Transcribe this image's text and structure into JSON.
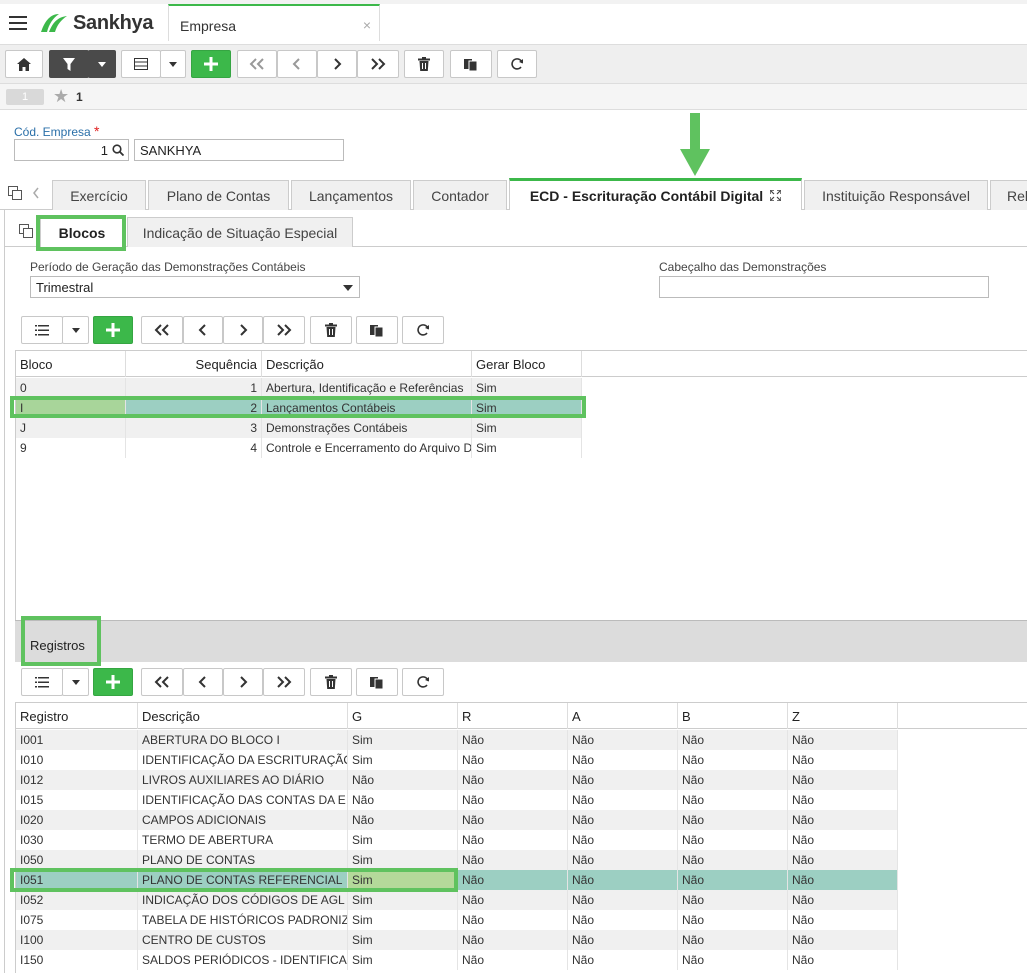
{
  "app": {
    "brand": "Sankhya",
    "tab_title": "Empresa",
    "tab_close": "×"
  },
  "record": {
    "index": "1",
    "favorites": "1"
  },
  "form": {
    "code_label": "Cód. Empresa",
    "required_mark": "*",
    "code_value": "1",
    "name_value": "SANKHYA"
  },
  "main_tabs": [
    {
      "label": "Exercício"
    },
    {
      "label": "Plano de Contas"
    },
    {
      "label": "Lançamentos"
    },
    {
      "label": "Contador"
    },
    {
      "label": "ECD - Escrituração Contábil Digital"
    },
    {
      "label": "Instituição Responsável"
    },
    {
      "label": "Rel"
    }
  ],
  "sub_tabs": [
    {
      "label": "Blocos"
    },
    {
      "label": "Indicação de Situação Especial"
    }
  ],
  "period": {
    "label": "Período de Geração das Demonstrações Contábeis",
    "value": "Trimestral"
  },
  "header_field": {
    "label": "Cabeçalho das Demonstrações",
    "value": ""
  },
  "blocos_grid": {
    "columns": [
      "Bloco",
      "Sequência",
      "Descrição",
      "Gerar Bloco"
    ],
    "rows": [
      [
        "0",
        "1",
        "Abertura, Identificação e Referências",
        "Sim"
      ],
      [
        "I",
        "2",
        "Lançamentos Contábeis",
        "Sim"
      ],
      [
        "J",
        "3",
        "Demonstrações Contábeis",
        "Sim"
      ],
      [
        "9",
        "4",
        "Controle e Encerramento do Arquivo D",
        "Sim"
      ]
    ],
    "selected_row": 1
  },
  "registros": {
    "title": "Registros",
    "columns": [
      "Registro",
      "Descrição",
      "G",
      "R",
      "A",
      "B",
      "Z"
    ],
    "rows": [
      [
        "I001",
        "ABERTURA DO BLOCO I",
        "Sim",
        "Não",
        "Não",
        "Não",
        "Não"
      ],
      [
        "I010",
        "IDENTIFICAÇÃO DA ESCRITURAÇÃO",
        "Sim",
        "Não",
        "Não",
        "Não",
        "Não"
      ],
      [
        "I012",
        "LIVROS AUXILIARES AO DIÁRIO",
        "Não",
        "Não",
        "Não",
        "Não",
        "Não"
      ],
      [
        "I015",
        "IDENTIFICAÇÃO DAS CONTAS DA E",
        "Não",
        "Não",
        "Não",
        "Não",
        "Não"
      ],
      [
        "I020",
        "CAMPOS ADICIONAIS",
        "Não",
        "Não",
        "Não",
        "Não",
        "Não"
      ],
      [
        "I030",
        "TERMO DE ABERTURA",
        "Sim",
        "Não",
        "Não",
        "Não",
        "Não"
      ],
      [
        "I050",
        "PLANO DE CONTAS",
        "Sim",
        "Não",
        "Não",
        "Não",
        "Não"
      ],
      [
        "I051",
        "PLANO DE CONTAS REFERENCIAL",
        "Sim",
        "Não",
        "Não",
        "Não",
        "Não"
      ],
      [
        "I052",
        "INDICAÇÃO DOS CÓDIGOS DE AGL",
        "Sim",
        "Não",
        "Não",
        "Não",
        "Não"
      ],
      [
        "I075",
        "TABELA DE HISTÓRICOS PADRONIZ",
        "Sim",
        "Não",
        "Não",
        "Não",
        "Não"
      ],
      [
        "I100",
        "CENTRO DE CUSTOS",
        "Sim",
        "Não",
        "Não",
        "Não",
        "Não"
      ],
      [
        "I150",
        "SALDOS PERIÓDICOS - IDENTIFICA",
        "Sim",
        "Não",
        "Não",
        "Não",
        "Não"
      ]
    ],
    "selected_row": 7
  },
  "colors": {
    "accent": "#3cb84a",
    "highlight": "#5fc25f",
    "selected_row": "#9ccfc2"
  }
}
